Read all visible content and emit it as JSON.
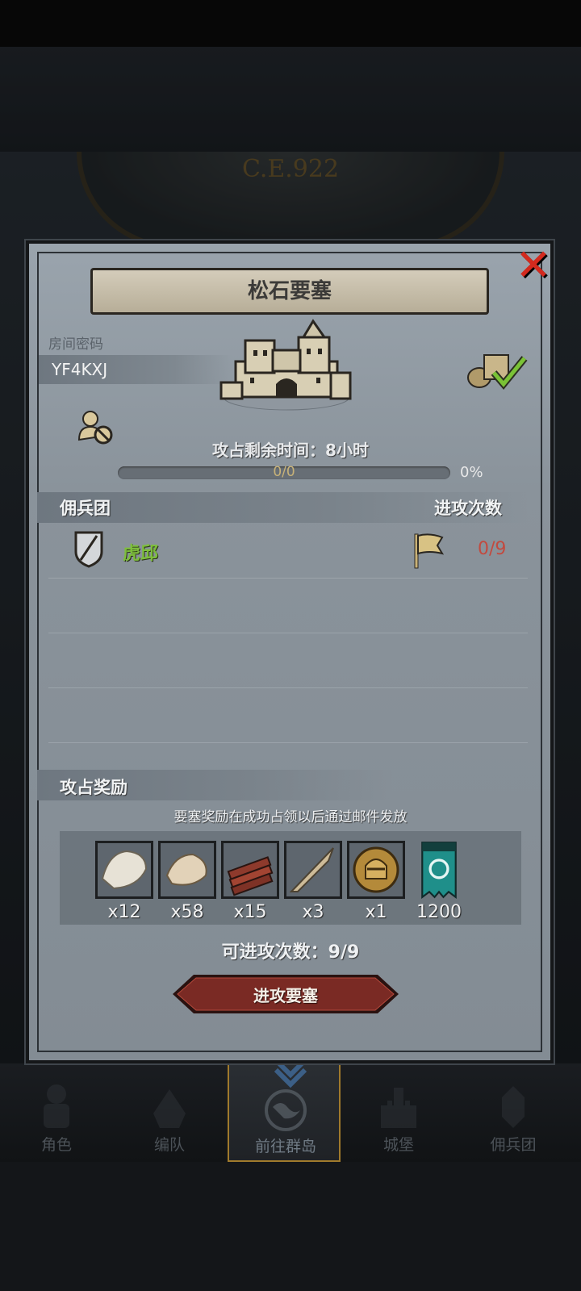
{
  "background": {
    "era_label": "C.E.922"
  },
  "dialog": {
    "title": "松石要塞",
    "room_code_label": "房间密码",
    "room_code": "YF4KXJ",
    "timer_text": "攻占剩余时间：8小时",
    "progress": {
      "text": "0/0",
      "percent_text": "0%",
      "fraction": 0
    },
    "mercenary_header": "佣兵团",
    "attack_count_header": "进攻次数",
    "mercenaries": [
      {
        "name": "虎邱",
        "attacks": "0/9"
      }
    ],
    "reward_header": "攻占奖励",
    "reward_note": "要塞奖励在成功占领以后通过邮件发放",
    "rewards": [
      {
        "icon": "white-fur-icon",
        "qty": "x12"
      },
      {
        "icon": "pelt-icon",
        "qty": "x58"
      },
      {
        "icon": "wood-planks-icon",
        "qty": "x15"
      },
      {
        "icon": "horn-icon",
        "qty": "x3"
      },
      {
        "icon": "knight-helmet-coin-icon",
        "qty": "x1"
      },
      {
        "icon": "banner-icon",
        "qty": "1200"
      }
    ],
    "attacks_left": "可进攻次数：9/9",
    "attack_button": "进攻要塞"
  },
  "nav": {
    "items": [
      {
        "label": "角色",
        "icon": "character-icon"
      },
      {
        "label": "编队",
        "icon": "formation-icon"
      },
      {
        "label": "前往群岛",
        "icon": "globe-icon",
        "active": true
      },
      {
        "label": "城堡",
        "icon": "castle-icon"
      },
      {
        "label": "佣兵团",
        "icon": "mercenary-icon"
      }
    ]
  },
  "colors": {
    "panel": "#8a939b",
    "merc_name": "#7dbe3c",
    "attack_count": "#c24a3f",
    "button": "#7a2a24",
    "close": "#d32a1e"
  }
}
